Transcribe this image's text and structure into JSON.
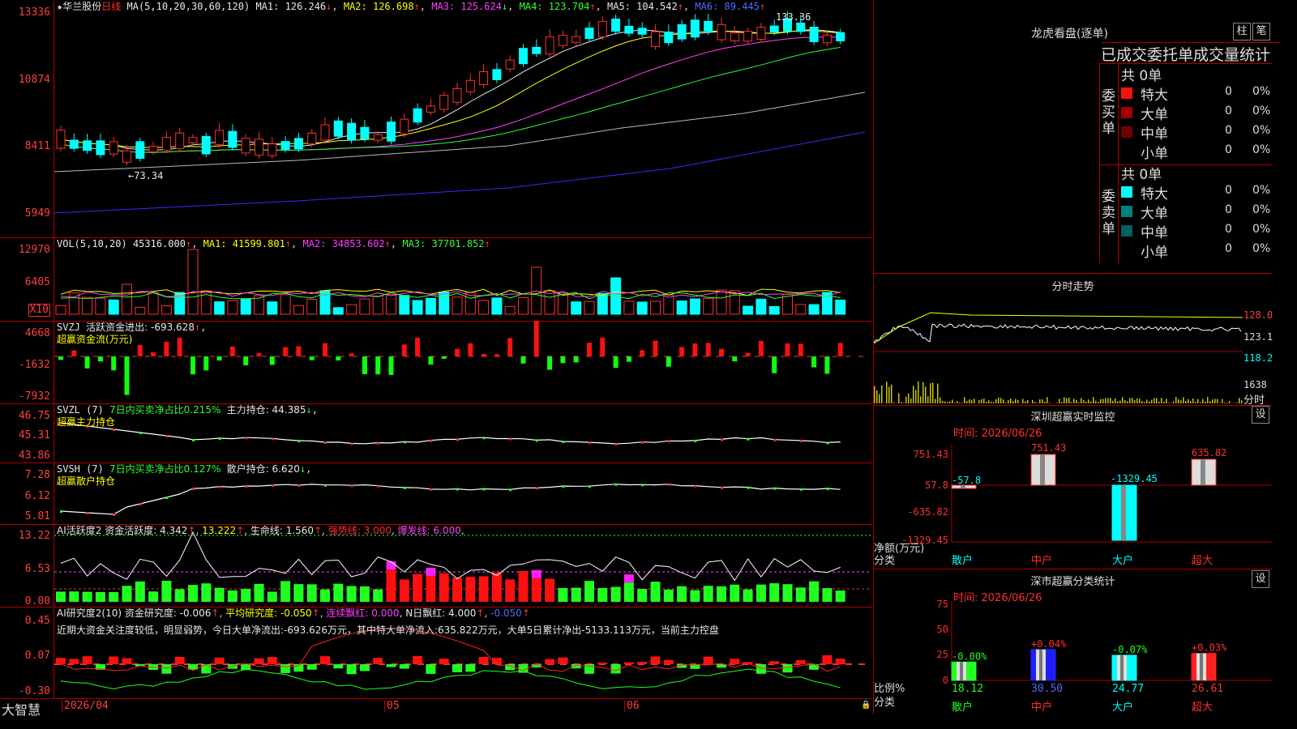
{
  "stock": {
    "name": "华兰股份",
    "period": "日线"
  },
  "main": {
    "ma_hdr": "MA(5,10,20,30,60,120)",
    "ma1": "MA1: 126.246",
    "ma2": "MA2: 126.698",
    "ma3": "MA3: 125.624",
    "ma4": "MA4: 123.704",
    "ma5": "MA5: 104.542",
    "ma6": "MA6: 89.445",
    "yticks": [
      "13336",
      "10874",
      "8411",
      "5949"
    ],
    "hi_label": "133.36",
    "lo_label": "73.34"
  },
  "vol": {
    "hdr": "VOL(5,10,20)",
    "value": "45316.000",
    "ma1": "MA1: 41599.801",
    "ma2": "MA2: 34853.602",
    "ma3": "MA3: 37701.852",
    "yticks": [
      "12970",
      "6405"
    ],
    "unit": "X10"
  },
  "svzj": {
    "hdr": "SVZJ",
    "title": "活跃资金进出: -693.628",
    "sub": "超赢资金流(万元)",
    "yticks": [
      "4668",
      "-1632",
      "-7932"
    ]
  },
  "svzl": {
    "hdr": "SVZL (7)",
    "ratio": "7日内买卖净占比0.215%",
    "hold": "主力持仓: 44.385",
    "sub": "超赢主力持仓",
    "yticks": [
      "46.75",
      "45.31",
      "43.86"
    ]
  },
  "svsh": {
    "hdr": "SVSH (7)",
    "ratio": "7日内买卖净占比0.127%",
    "hold": "散户持仓: 6.620",
    "sub": "超赢散户持仓",
    "yticks": [
      "7.28",
      "6.12",
      "5.01"
    ]
  },
  "ai1": {
    "hdr": "AI活跃度2",
    "act": "资金活跃度: 4.342",
    "v2": "13.222",
    "life": "生命线: 1.560",
    "strong": "强势线: 3.000",
    "burst": "爆发线: 6.000",
    "yticks": [
      "13.22",
      "6.53",
      "0.00"
    ]
  },
  "ai2": {
    "hdr": "AI研究度2(10)",
    "res": "资金研究度: -0.006",
    "avg": "平均研究度: -0.050",
    "cont": "连续飘红: 0.000",
    "n": "N日飘红: 4.000",
    "last": "-0.050",
    "comment": "近期大资金关注度较低，明显弱势，今日大单净流出:-693.626万元，其中特大单净流入:635.822万元，大单5日累计净出-5133.113万元，当前主力控盘",
    "yticks": [
      "0.45",
      "0.07",
      "-0.30"
    ]
  },
  "dates": [
    "2026/04",
    "05",
    "06"
  ],
  "brand": "大智慧",
  "lhb": {
    "title": "龙虎看盘(逐单)",
    "btn1": "柱",
    "btn2": "笔",
    "tabs": "已成交委托单成交量统计",
    "buy": {
      "side": "委买单",
      "total": "共 0单",
      "rows": [
        {
          "label": "特大",
          "n": "0",
          "p": "0%"
        },
        {
          "label": "大单",
          "n": "0",
          "p": "0%"
        },
        {
          "label": "中单",
          "n": "0",
          "p": "0%"
        },
        {
          "label": "小单",
          "n": "0",
          "p": "0%"
        }
      ]
    },
    "sell": {
      "side": "委卖单",
      "total": "共 0单",
      "rows": [
        {
          "label": "特大",
          "n": "0",
          "p": "0%"
        },
        {
          "label": "大单",
          "n": "0",
          "p": "0%"
        },
        {
          "label": "中单",
          "n": "0",
          "p": "0%"
        },
        {
          "label": "小单",
          "n": "0",
          "p": "0%"
        }
      ]
    },
    "colors": {
      "buy": [
        "#ff1010",
        "#a00000",
        "#700000",
        "#000000"
      ],
      "sell": [
        "#00ffff",
        "#008080",
        "#006060",
        "#000000"
      ]
    }
  },
  "fenshi": {
    "title": "分时走势",
    "yticks": [
      "128.0",
      "123.1",
      "118.2"
    ],
    "vol": "1638",
    "unit": "分时"
  },
  "szjk": {
    "title": "深圳超赢实时监控",
    "btn": "设",
    "time": "时间: 2026/06/26",
    "yticks": [
      "751.43",
      "57.8",
      "-635.82",
      "-1329.45"
    ],
    "axis_label": "净额(万元)",
    "cat_label": "分类",
    "bars": [
      {
        "name": "散户",
        "v": "-57.8"
      },
      {
        "name": "中户",
        "v": "751.43"
      },
      {
        "name": "大户",
        "v": "-1329.45"
      },
      {
        "name": "超大",
        "v": "635.82"
      }
    ]
  },
  "szfl": {
    "title": "深市超赢分类统计",
    "btn": "设",
    "time": "时间: 2026/06/26",
    "yticks": [
      "75",
      "50",
      "25",
      "0"
    ],
    "axis_label": "比例%",
    "cat_label": "分类",
    "bars": [
      {
        "name": "散户",
        "pct": "18.12",
        "chg": "-0.00%"
      },
      {
        "name": "中户",
        "pct": "30.50",
        "chg": "+0.04%"
      },
      {
        "name": "大户",
        "pct": "24.77",
        "chg": "-0.07%"
      },
      {
        "name": "超大",
        "pct": "26.61",
        "chg": "+0.03%"
      }
    ]
  }
}
